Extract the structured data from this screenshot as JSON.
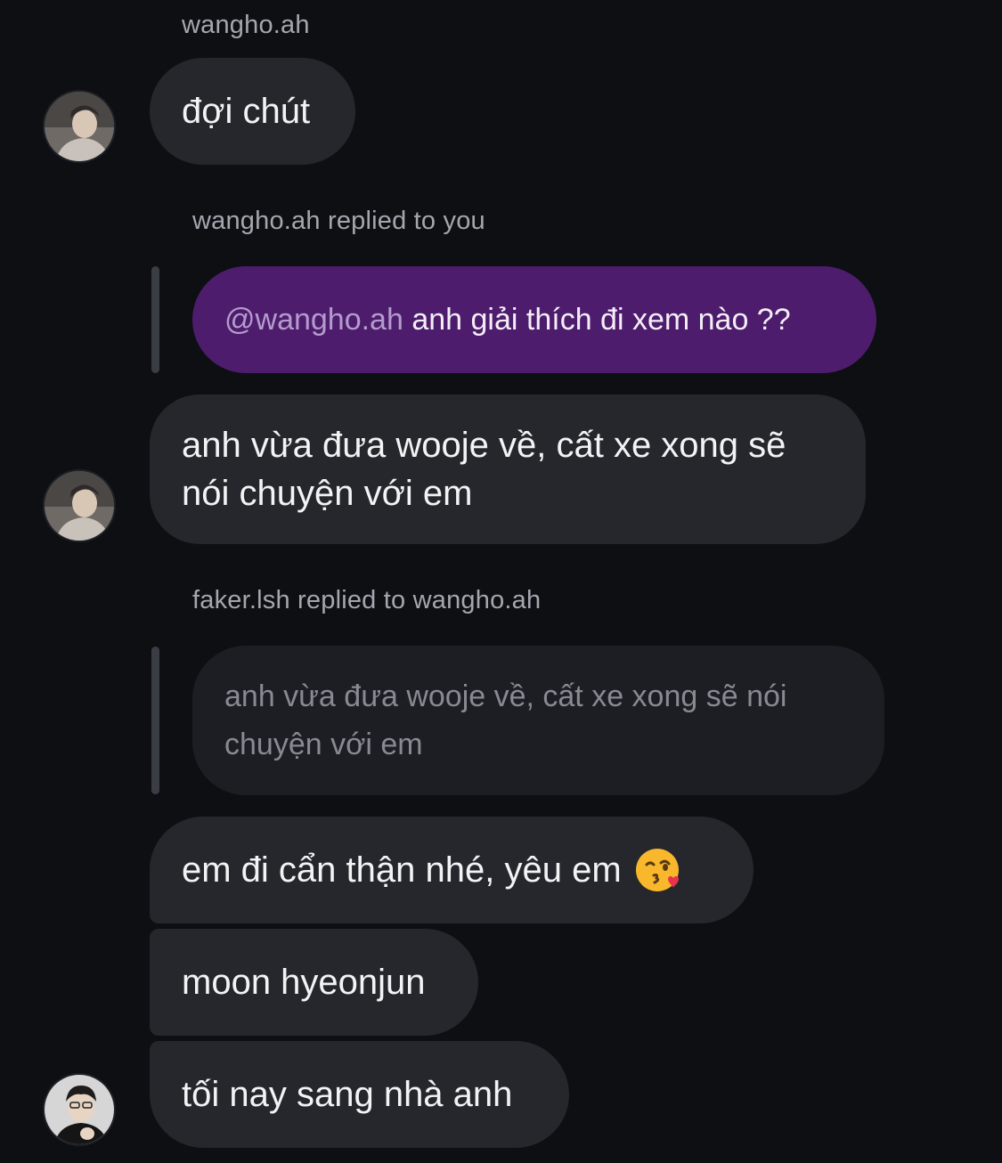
{
  "thread": {
    "sender_name": "wangho.ah",
    "messages": [
      {
        "text": "đợi chút"
      },
      {
        "reply_caption": "wangho.ah replied to you",
        "quoted_mention": "@wangho.ah",
        "quoted_text": "anh giải thích đi xem nào ??",
        "text": "anh vừa đưa wooje về, cất xe xong sẽ nói chuyện với em"
      },
      {
        "reply_caption": "faker.lsh replied to wangho.ah",
        "quoted_text": "anh vừa đưa wooje về, cất xe xong sẽ nói chuyện với em"
      },
      {
        "text": "em đi cẩn thận nhé, yêu em",
        "emoji": "kissing-face-with-heart-emoji"
      },
      {
        "text": "moon hyeonjun"
      },
      {
        "text": "tối nay sang nhà anh"
      }
    ]
  },
  "colors": {
    "background": "#0d0f13",
    "incoming_bubble": "#25272c",
    "own_quoted_bubble": "#4e1c6c",
    "caption_text": "#a3a7ae"
  }
}
